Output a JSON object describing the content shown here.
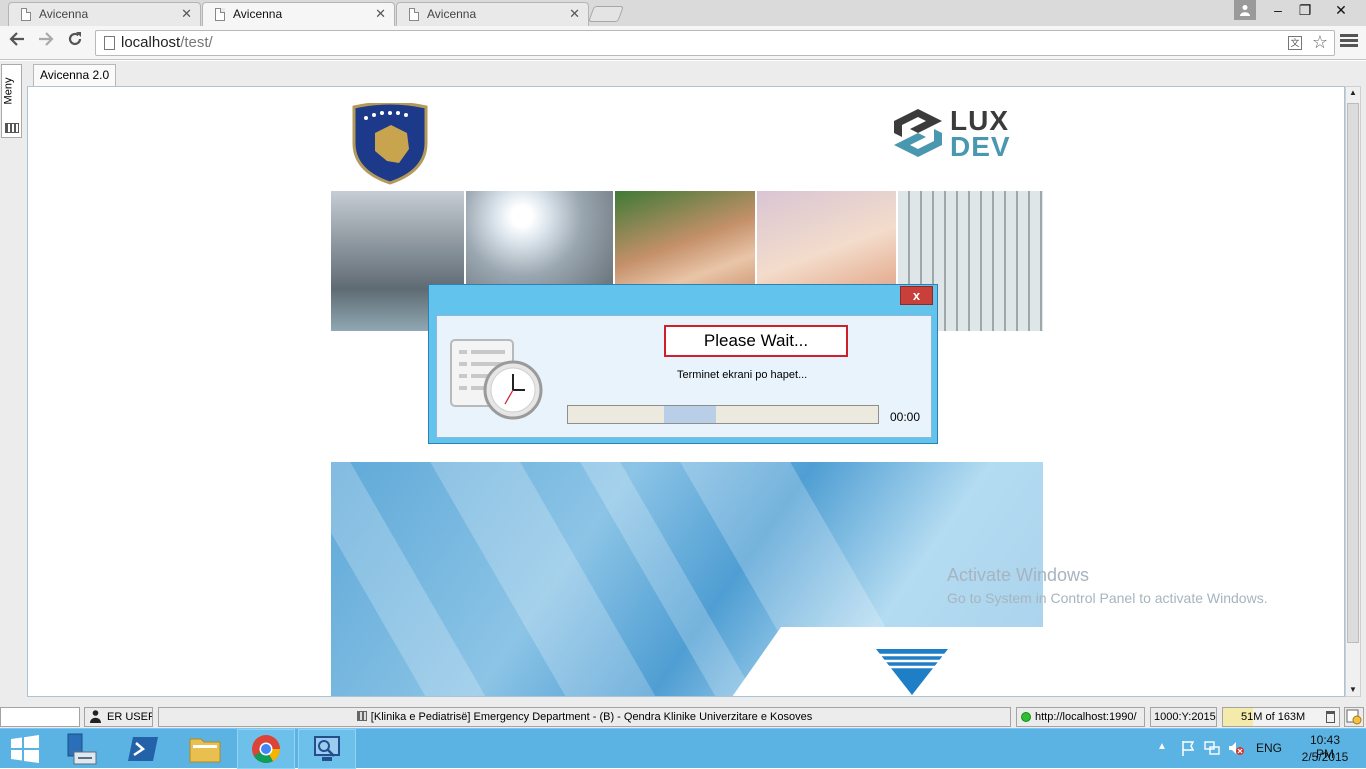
{
  "browser": {
    "tabs": [
      {
        "title": "Avicenna",
        "active": false
      },
      {
        "title": "Avicenna",
        "active": true
      },
      {
        "title": "Avicenna",
        "active": false
      }
    ],
    "url_host": "localhost",
    "url_path": "/test/",
    "window_buttons": {
      "minimize": "–",
      "maximize": "❐",
      "close": "✕"
    }
  },
  "app": {
    "sidebar_label": "Meny",
    "tab_label": "Avicenna 2.0",
    "logo_lux": "LUX",
    "logo_dev": "DEV"
  },
  "dialog": {
    "title_text": "Please Wait...",
    "message": "Terminet  ekrani po hapet...",
    "progress_time": "00:00",
    "progress_fraction": 0.17,
    "close_label": "x"
  },
  "watermark": {
    "title": "Activate Windows",
    "subtitle": "Go to System in Control Panel to activate Windows."
  },
  "statusbar": {
    "user": "ER USER",
    "department": "[Klinika e Pediatrisë] Emergency Department - (B) - Qendra Klinike Univerzitare e Kosoves",
    "server_url": "http://localhost:1990/",
    "code": "1000:Y:2015",
    "memory_used": "51M",
    "memory_of": "of 163M"
  },
  "taskbar": {
    "language": "ENG",
    "time": "10:43 PM",
    "date": "2/5/2015"
  },
  "colors": {
    "taskbar": "#5bb3e4",
    "dialog_frame": "#62c3ec",
    "dialog_close": "#c9403b",
    "highlight_border": "#d11e2b",
    "lux_dark": "#3b3b3b",
    "lux_blue": "#4a97b0"
  }
}
